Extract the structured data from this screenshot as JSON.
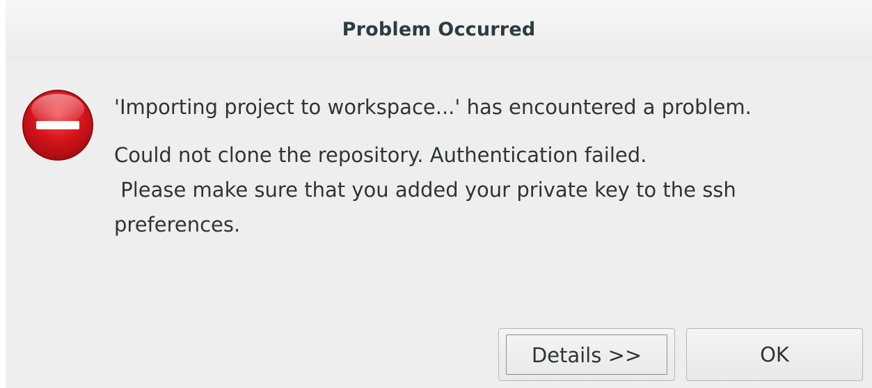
{
  "dialog": {
    "title": "Problem Occurred",
    "icon": "error-icon",
    "headline": "'Importing project to workspace...' has encountered a problem.",
    "detail": "Could not clone the repository. Authentication failed.\n Please make sure that you added your private key to the ssh\npreferences.",
    "buttons": {
      "details_label": "Details >>",
      "ok_label": "OK"
    }
  },
  "colors": {
    "error_red": "#d8141c",
    "dialog_bg": "#eeeeee",
    "title_text": "#2e3b41"
  }
}
